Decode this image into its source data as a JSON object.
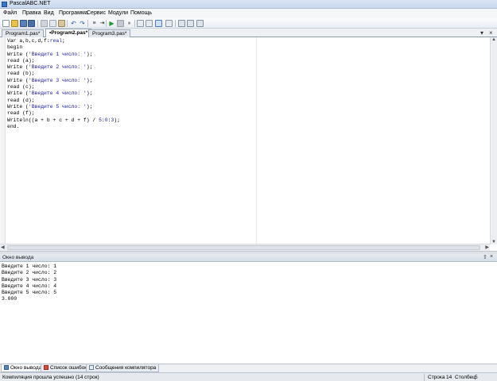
{
  "window": {
    "title": "PascalABC.NET"
  },
  "menu": [
    "Файл",
    "Правка",
    "Вид",
    "Программа",
    "Сервис",
    "Модули",
    "Помощь"
  ],
  "tabs": [
    {
      "label": "Program1.pas*",
      "active": false
    },
    {
      "label": "•Program2.pas*",
      "active": true
    },
    {
      "label": "Program3.pas*",
      "active": false
    }
  ],
  "tab_controls": {
    "dropdown": "▾",
    "close": "×"
  },
  "editor": {
    "lines": [
      [
        {
          "t": "Var a,b,c,d,f:",
          "c": "kw"
        },
        {
          "t": "real",
          "c": "type"
        },
        {
          "t": ";",
          "c": "kw"
        }
      ],
      [
        {
          "t": "begin",
          "c": "kw"
        }
      ],
      [
        {
          "t": "Write (",
          "c": "kw"
        },
        {
          "t": "'Введите 1 число: '",
          "c": "str"
        },
        {
          "t": ");",
          "c": "kw"
        }
      ],
      [
        {
          "t": "read (a);",
          "c": "kw"
        }
      ],
      [
        {
          "t": "Write (",
          "c": "kw"
        },
        {
          "t": "'Введите 2 число: '",
          "c": "str"
        },
        {
          "t": ");",
          "c": "kw"
        }
      ],
      [
        {
          "t": "read (b);",
          "c": "kw"
        }
      ],
      [
        {
          "t": "Write (",
          "c": "kw"
        },
        {
          "t": "'Введите 3 число: '",
          "c": "str"
        },
        {
          "t": ");",
          "c": "kw"
        }
      ],
      [
        {
          "t": "read (c);",
          "c": "kw"
        }
      ],
      [
        {
          "t": "Write (",
          "c": "kw"
        },
        {
          "t": "'Введите 4 число: '",
          "c": "str"
        },
        {
          "t": ");",
          "c": "kw"
        }
      ],
      [
        {
          "t": "read (d);",
          "c": "kw"
        }
      ],
      [
        {
          "t": "Write (",
          "c": "kw"
        },
        {
          "t": "'Введите 5 число: '",
          "c": "str"
        },
        {
          "t": ");",
          "c": "kw"
        }
      ],
      [
        {
          "t": "read (f);",
          "c": "kw"
        }
      ],
      [
        {
          "t": "Writeln((a + b + c + d + f) / ",
          "c": "kw"
        },
        {
          "t": "5",
          "c": "num"
        },
        {
          "t": ":",
          "c": "kw"
        },
        {
          "t": "0",
          "c": "num"
        },
        {
          "t": ":",
          "c": "kw"
        },
        {
          "t": "3",
          "c": "num"
        },
        {
          "t": ");",
          "c": "kw"
        }
      ],
      [
        {
          "t": "end.",
          "c": "kw"
        }
      ]
    ]
  },
  "output_panel": {
    "title": "Окно вывода",
    "pin_glyph": "⇧",
    "close_glyph": "×",
    "lines": [
      "Введите 1 число: 1",
      "Введите 2 число: 2",
      "Введите 3 число: 3",
      "Введите 4 число: 4",
      "Введите 5 число: 5",
      "3.000"
    ]
  },
  "bottom_tabs": [
    {
      "label": "Окно вывода",
      "active": true,
      "icon": "output-window-icon"
    },
    {
      "label": "Список ошибок",
      "active": false,
      "icon": "error-list-icon"
    },
    {
      "label": "Сообщения компилятора",
      "active": false,
      "icon": "compiler-messages-icon"
    }
  ],
  "status": {
    "message": "Компиляция прошла успешно (14 строк)",
    "row_label": "Строка",
    "row_value": "14",
    "col_label": "Столбец",
    "col_value": "5"
  },
  "colors": {
    "string": "#1a1ab0",
    "accent": "#4a7fc4"
  }
}
